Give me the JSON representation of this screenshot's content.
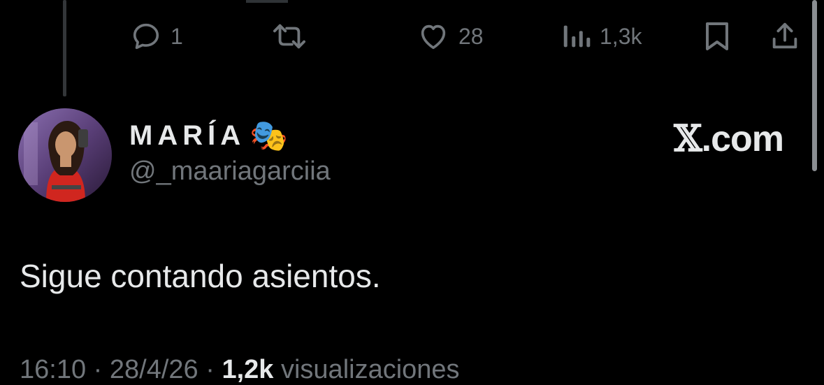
{
  "actions": {
    "reply_count": "1",
    "retweet_count": "",
    "like_count": "28",
    "views_count": "1,3k"
  },
  "tweet": {
    "display_name": "MARÍA",
    "name_emoji": "🎭",
    "handle": "@_maariagarciia",
    "text": "Sigue contando asientos.",
    "time": "16:10",
    "separator": "·",
    "date": "28/4/26",
    "views": "1,2k",
    "views_label": "visualizaciones"
  },
  "brand": {
    "label": ".com"
  },
  "colors": {
    "background": "#000000",
    "primary_text": "#e7e9ea",
    "secondary_text": "#71767b"
  },
  "icons": [
    "reply-icon",
    "retweet-icon",
    "like-icon",
    "views-icon",
    "bookmark-icon",
    "share-icon",
    "avatar-photo",
    "x-logo"
  ]
}
